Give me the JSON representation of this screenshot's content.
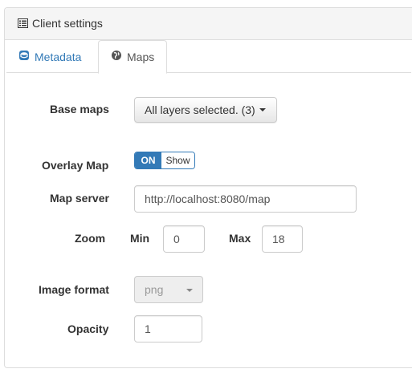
{
  "panel": {
    "title": "Client settings"
  },
  "tabs": [
    {
      "label": "Metadata",
      "active": false
    },
    {
      "label": "Maps",
      "active": true
    }
  ],
  "form": {
    "base_maps": {
      "label": "Base maps",
      "value": "All layers selected. (3)"
    },
    "overlay_map": {
      "label": "Overlay Map",
      "on_label": "ON",
      "off_label": "Show",
      "state": "on"
    },
    "map_server": {
      "label": "Map server",
      "value": "http://localhost:8080/map"
    },
    "zoom": {
      "label": "Zoom",
      "min_label": "Min",
      "min_value": "0",
      "max_label": "Max",
      "max_value": "18"
    },
    "image_format": {
      "label": "Image format",
      "value": "png"
    },
    "opacity": {
      "label": "Opacity",
      "value": "1"
    }
  },
  "colors": {
    "accent": "#337ab7",
    "border": "#dddddd",
    "heading_bg": "#f5f5f5"
  },
  "icons": {
    "panel": "list-icon",
    "metadata": "database-icon",
    "maps": "globe-icon"
  }
}
